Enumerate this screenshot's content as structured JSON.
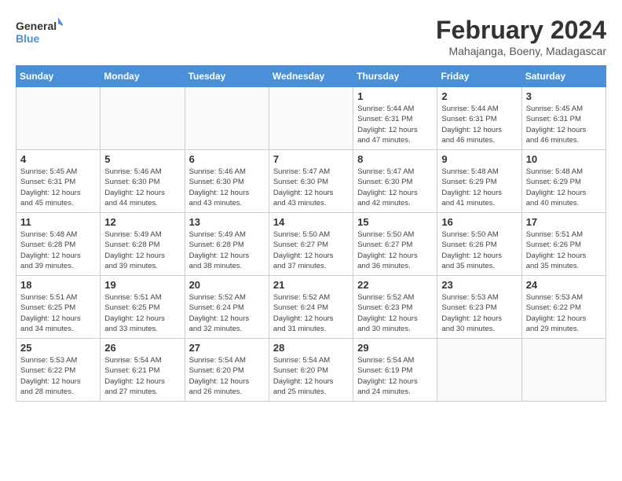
{
  "header": {
    "logo_line1": "General",
    "logo_line2": "Blue",
    "month_year": "February 2024",
    "location": "Mahajanga, Boeny, Madagascar"
  },
  "days_of_week": [
    "Sunday",
    "Monday",
    "Tuesday",
    "Wednesday",
    "Thursday",
    "Friday",
    "Saturday"
  ],
  "weeks": [
    [
      {
        "day": "",
        "info": ""
      },
      {
        "day": "",
        "info": ""
      },
      {
        "day": "",
        "info": ""
      },
      {
        "day": "",
        "info": ""
      },
      {
        "day": "1",
        "info": "Sunrise: 5:44 AM\nSunset: 6:31 PM\nDaylight: 12 hours\nand 47 minutes."
      },
      {
        "day": "2",
        "info": "Sunrise: 5:44 AM\nSunset: 6:31 PM\nDaylight: 12 hours\nand 46 minutes."
      },
      {
        "day": "3",
        "info": "Sunrise: 5:45 AM\nSunset: 6:31 PM\nDaylight: 12 hours\nand 46 minutes."
      }
    ],
    [
      {
        "day": "4",
        "info": "Sunrise: 5:45 AM\nSunset: 6:31 PM\nDaylight: 12 hours\nand 45 minutes."
      },
      {
        "day": "5",
        "info": "Sunrise: 5:46 AM\nSunset: 6:30 PM\nDaylight: 12 hours\nand 44 minutes."
      },
      {
        "day": "6",
        "info": "Sunrise: 5:46 AM\nSunset: 6:30 PM\nDaylight: 12 hours\nand 43 minutes."
      },
      {
        "day": "7",
        "info": "Sunrise: 5:47 AM\nSunset: 6:30 PM\nDaylight: 12 hours\nand 43 minutes."
      },
      {
        "day": "8",
        "info": "Sunrise: 5:47 AM\nSunset: 6:30 PM\nDaylight: 12 hours\nand 42 minutes."
      },
      {
        "day": "9",
        "info": "Sunrise: 5:48 AM\nSunset: 6:29 PM\nDaylight: 12 hours\nand 41 minutes."
      },
      {
        "day": "10",
        "info": "Sunrise: 5:48 AM\nSunset: 6:29 PM\nDaylight: 12 hours\nand 40 minutes."
      }
    ],
    [
      {
        "day": "11",
        "info": "Sunrise: 5:48 AM\nSunset: 6:28 PM\nDaylight: 12 hours\nand 39 minutes."
      },
      {
        "day": "12",
        "info": "Sunrise: 5:49 AM\nSunset: 6:28 PM\nDaylight: 12 hours\nand 39 minutes."
      },
      {
        "day": "13",
        "info": "Sunrise: 5:49 AM\nSunset: 6:28 PM\nDaylight: 12 hours\nand 38 minutes."
      },
      {
        "day": "14",
        "info": "Sunrise: 5:50 AM\nSunset: 6:27 PM\nDaylight: 12 hours\nand 37 minutes."
      },
      {
        "day": "15",
        "info": "Sunrise: 5:50 AM\nSunset: 6:27 PM\nDaylight: 12 hours\nand 36 minutes."
      },
      {
        "day": "16",
        "info": "Sunrise: 5:50 AM\nSunset: 6:26 PM\nDaylight: 12 hours\nand 35 minutes."
      },
      {
        "day": "17",
        "info": "Sunrise: 5:51 AM\nSunset: 6:26 PM\nDaylight: 12 hours\nand 35 minutes."
      }
    ],
    [
      {
        "day": "18",
        "info": "Sunrise: 5:51 AM\nSunset: 6:25 PM\nDaylight: 12 hours\nand 34 minutes."
      },
      {
        "day": "19",
        "info": "Sunrise: 5:51 AM\nSunset: 6:25 PM\nDaylight: 12 hours\nand 33 minutes."
      },
      {
        "day": "20",
        "info": "Sunrise: 5:52 AM\nSunset: 6:24 PM\nDaylight: 12 hours\nand 32 minutes."
      },
      {
        "day": "21",
        "info": "Sunrise: 5:52 AM\nSunset: 6:24 PM\nDaylight: 12 hours\nand 31 minutes."
      },
      {
        "day": "22",
        "info": "Sunrise: 5:52 AM\nSunset: 6:23 PM\nDaylight: 12 hours\nand 30 minutes."
      },
      {
        "day": "23",
        "info": "Sunrise: 5:53 AM\nSunset: 6:23 PM\nDaylight: 12 hours\nand 30 minutes."
      },
      {
        "day": "24",
        "info": "Sunrise: 5:53 AM\nSunset: 6:22 PM\nDaylight: 12 hours\nand 29 minutes."
      }
    ],
    [
      {
        "day": "25",
        "info": "Sunrise: 5:53 AM\nSunset: 6:22 PM\nDaylight: 12 hours\nand 28 minutes."
      },
      {
        "day": "26",
        "info": "Sunrise: 5:54 AM\nSunset: 6:21 PM\nDaylight: 12 hours\nand 27 minutes."
      },
      {
        "day": "27",
        "info": "Sunrise: 5:54 AM\nSunset: 6:20 PM\nDaylight: 12 hours\nand 26 minutes."
      },
      {
        "day": "28",
        "info": "Sunrise: 5:54 AM\nSunset: 6:20 PM\nDaylight: 12 hours\nand 25 minutes."
      },
      {
        "day": "29",
        "info": "Sunrise: 5:54 AM\nSunset: 6:19 PM\nDaylight: 12 hours\nand 24 minutes."
      },
      {
        "day": "",
        "info": ""
      },
      {
        "day": "",
        "info": ""
      }
    ]
  ]
}
